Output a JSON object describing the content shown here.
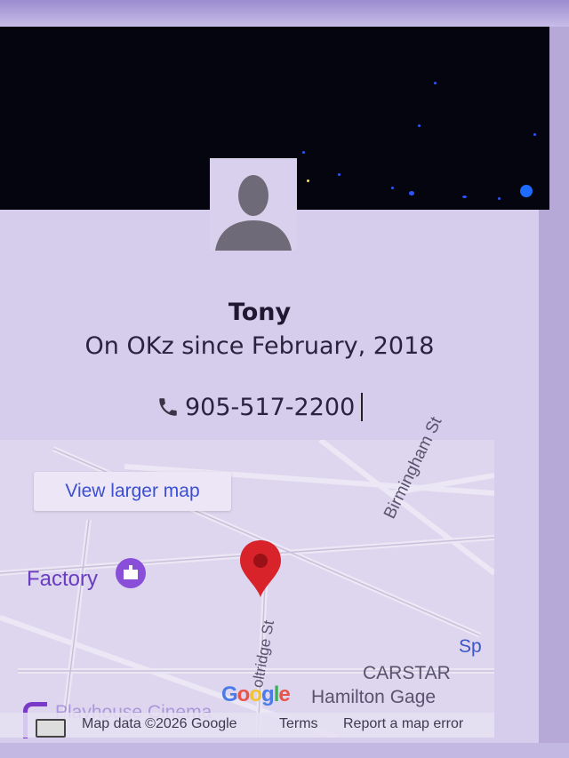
{
  "profile": {
    "name": "Tony",
    "since": "On OKz since February, 2018",
    "phone": "905-517-2200"
  },
  "map": {
    "view_larger": "View larger map",
    "labels": {
      "factory": "Factory",
      "birmingham": "Birmingham St",
      "oltridge": "oltridge St",
      "carstar": "CARSTAR",
      "hamilton": "Hamilton Gage",
      "sp": "Sp",
      "playhouse": "Playhouse Cinema"
    },
    "google_logo": "Google",
    "footer": {
      "map_data": "Map data ©2026 Google",
      "terms": "Terms",
      "report": "Report a map error"
    }
  },
  "colors": {
    "cover": "#050510",
    "card": "#d6cceb",
    "link": "#3b4fd0",
    "pin": "#d8232a",
    "factory": "#6a3dc0"
  },
  "icons": [
    "avatar-silhouette",
    "phone-icon",
    "map-pin-icon",
    "factory-poi-icon",
    "keyboard-icon"
  ]
}
